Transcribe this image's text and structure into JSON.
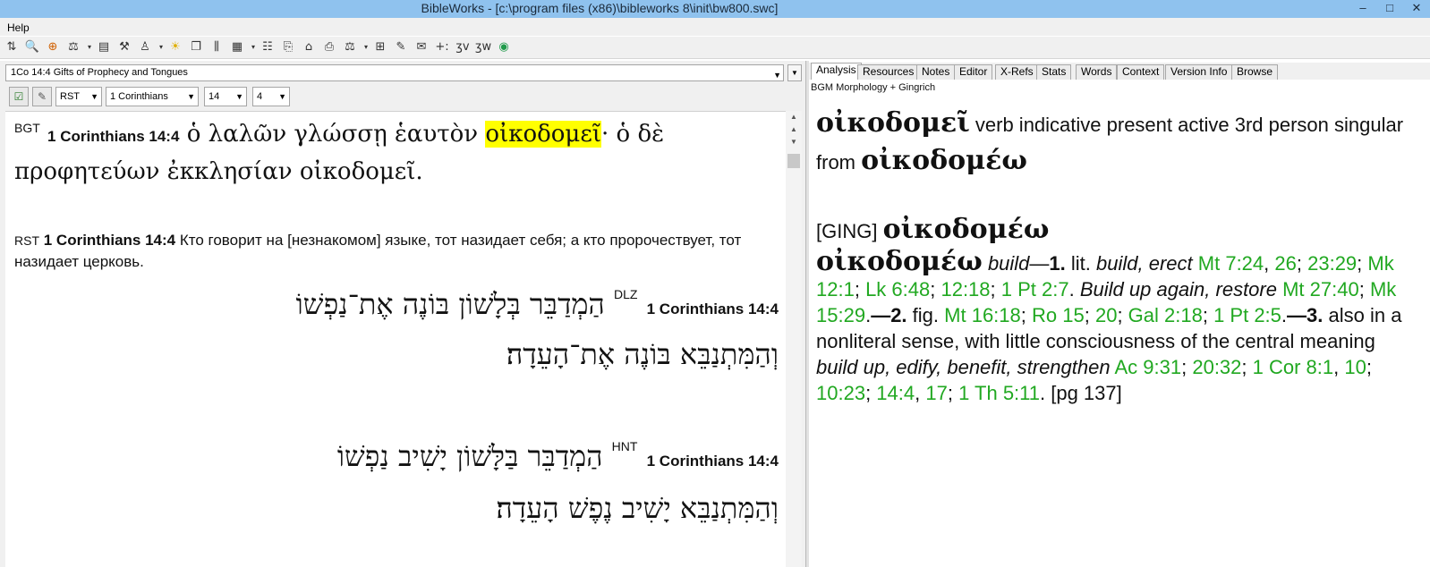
{
  "window": {
    "title": "BibleWorks - [c:\\program files (x86)\\bibleworks 8\\init\\bw800.swc]",
    "minimize": "–",
    "maximize": "□",
    "close": "✕"
  },
  "menu": {
    "help": "Help"
  },
  "toolbar": {
    "icons": [
      {
        "name": "split-icon",
        "glyph": "⇅"
      },
      {
        "name": "search-icon",
        "glyph": "🔍"
      },
      {
        "name": "target-icon",
        "glyph": "⊕"
      },
      {
        "name": "scale-icon",
        "glyph": "⚖"
      },
      {
        "name": "dropdown-icon",
        "glyph": "▾"
      },
      {
        "name": "book-icon",
        "glyph": "▤"
      },
      {
        "name": "tools-icon",
        "glyph": "⚒"
      },
      {
        "name": "person-icon",
        "glyph": "♙"
      },
      {
        "name": "dropdown-icon",
        "glyph": "▾"
      },
      {
        "name": "lamp-icon",
        "glyph": "☀"
      },
      {
        "name": "windows-icon",
        "glyph": "❐"
      },
      {
        "name": "columns-icon",
        "glyph": "⫼"
      },
      {
        "name": "grid-icon",
        "glyph": "▦"
      },
      {
        "name": "dropdown-icon",
        "glyph": "▾"
      },
      {
        "name": "list-icon",
        "glyph": "☷"
      },
      {
        "name": "copy-icon",
        "glyph": "⎘"
      },
      {
        "name": "folder-icon",
        "glyph": "⌂"
      },
      {
        "name": "printer-icon",
        "glyph": "⎙"
      },
      {
        "name": "balance-icon",
        "glyph": "⚖"
      },
      {
        "name": "dropdown-icon",
        "glyph": "▾"
      },
      {
        "name": "layout-icon",
        "glyph": "⊞"
      },
      {
        "name": "note-icon",
        "glyph": "✎"
      },
      {
        "name": "stamp-icon",
        "glyph": "✉"
      },
      {
        "name": "add-icon",
        "glyph": "+:"
      },
      {
        "name": "verse-icon",
        "glyph": "ʒv"
      },
      {
        "name": "word-icon",
        "glyph": "ʒw"
      },
      {
        "name": "globe-icon",
        "glyph": "◉"
      }
    ]
  },
  "left": {
    "verse_title": "1Co 14:4 Gifts of Prophecy and Tongues",
    "version_select": "RST",
    "book_select": "1 Corinthians",
    "chapter_select": "14",
    "verse_select": "4",
    "greek": {
      "version": "BGT",
      "ref": "1 Corinthians 14:4",
      "line1_pre": "ὁ λαλῶν γλώσσῃ ἑαυτὸν ",
      "highlight": "οἰκοδομεῖ",
      "line1_post": "· ὁ δὲ",
      "line2": "προφητεύων ἐκκλησίαν οἰκοδομεῖ."
    },
    "russian": {
      "version": "RST",
      "ref": "1 Corinthians 14:4",
      "text": "Кто говорит на [незнакомом] языке, тот назидает себя; а кто пророчествует, тот назидает церковь."
    },
    "hebrew_dlz": {
      "version": "DLZ",
      "ref": "1 Corinthians 14:4",
      "line1": "הַמְדַבֵּר בְּלָשׁוֹן בּוֹנֶה אֶת־נַפְשׁוֹ",
      "line2": "וְהַמִּתְנַבֵּא בּוֹנֶה אֶת־הָעֵדָה׃"
    },
    "hebrew_hnt": {
      "version": "HNT",
      "ref": "1 Corinthians 14:4",
      "line1": "הַמְדַבֵּר בַּלָּשׁוֹן יָשִׁיב נַפְשׁוֹ",
      "line2": "וְהַמִּתְנַבֵּא יָשִׁיב נֶפֶשׁ הָעֵדָה׃"
    }
  },
  "right": {
    "tabs": [
      "Analysis",
      "Resources",
      "Notes",
      "Editor",
      "X-Refs",
      "Stats",
      "Words",
      "Context",
      "Version Info",
      "Browse"
    ],
    "subtitle": "BGM Morphology + Gingrich",
    "analysis": {
      "word": "οἰκοδομεῖ",
      "parse": "verb indicative present active 3rd person singular from",
      "lemma": "οἰκοδομέω"
    },
    "ging": {
      "tag": "[GING]",
      "lemma": "οἰκοδομέω",
      "entry_word": "οἰκοδομέω",
      "def_build": "build",
      "dash1": "—",
      "n1": "1.",
      "lit": "lit.",
      "build_erect": "build, erect",
      "ref_mt724": "Mt 7:24",
      "ref_26": "26",
      "ref_2329": "23:29",
      "ref_mk121": "Mk 12:1",
      "ref_lk648": "Lk 6:48",
      "ref_1218": "12:18",
      "ref_1pt27": "1 Pt 2:7",
      "build_up_again": "Build up again, restore",
      "ref_mt2740": "Mt 27:40",
      "ref_mk1529": "Mk 15:29",
      "n2": "2.",
      "fig": "fig.",
      "ref_mt1618": "Mt 16:18",
      "ref_ro15": "Ro 15",
      "ref_20": "20",
      "ref_gal218": "Gal 2:18",
      "ref_1pt25": "1 Pt 2:5",
      "n3": "3.",
      "also": "also in a nonliteral sense, with little consciousness of the central meaning",
      "edify": "build up, edify, benefit, strengthen",
      "ref_ac931": "Ac 9:31",
      "ref_2032": "20:32",
      "ref_1cor81": "1 Cor 8:1",
      "ref_10": "10",
      "ref_1023": "10:23",
      "ref_144": "14:4",
      "ref_17": "17",
      "ref_1th511": "1 Th 5:11",
      "pg": "[pg 137]"
    }
  }
}
